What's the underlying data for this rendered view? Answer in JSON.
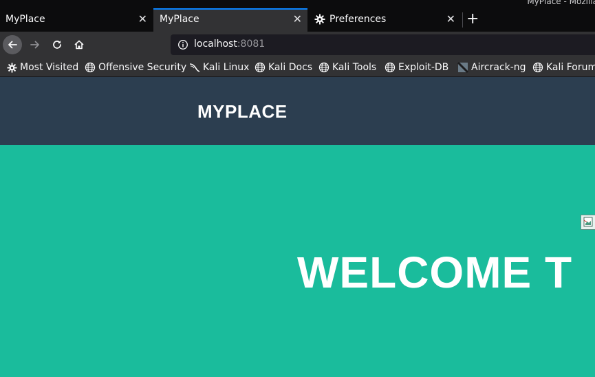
{
  "window": {
    "title": "MyPlace - Mozilla"
  },
  "tabs": [
    {
      "label": "MyPlace",
      "active": false
    },
    {
      "label": "MyPlace",
      "active": true
    },
    {
      "label": "Preferences",
      "active": false,
      "icon": "gear-icon"
    }
  ],
  "nav": {
    "url_host": "localhost",
    "url_port": ":8081"
  },
  "bookmarks": [
    {
      "label": "Most Visited",
      "icon": "gear-icon"
    },
    {
      "label": "Offensive Security",
      "icon": "globe-icon"
    },
    {
      "label": "Kali Linux",
      "icon": "kali-dragon-icon"
    },
    {
      "label": "Kali Docs",
      "icon": "globe-icon"
    },
    {
      "label": "Kali Tools",
      "icon": "globe-icon"
    },
    {
      "label": "Exploit-DB",
      "icon": "globe-icon"
    },
    {
      "label": "Aircrack-ng",
      "icon": "aircrack-icon"
    },
    {
      "label": "Kali Forums",
      "icon": "globe-icon"
    }
  ],
  "page": {
    "brand": "MYPLACE",
    "hero_title": "WELCOME T"
  },
  "colors": {
    "header_bg": "#2c3e50",
    "hero_bg": "#1abc9c",
    "accent": "#0a84ff"
  }
}
